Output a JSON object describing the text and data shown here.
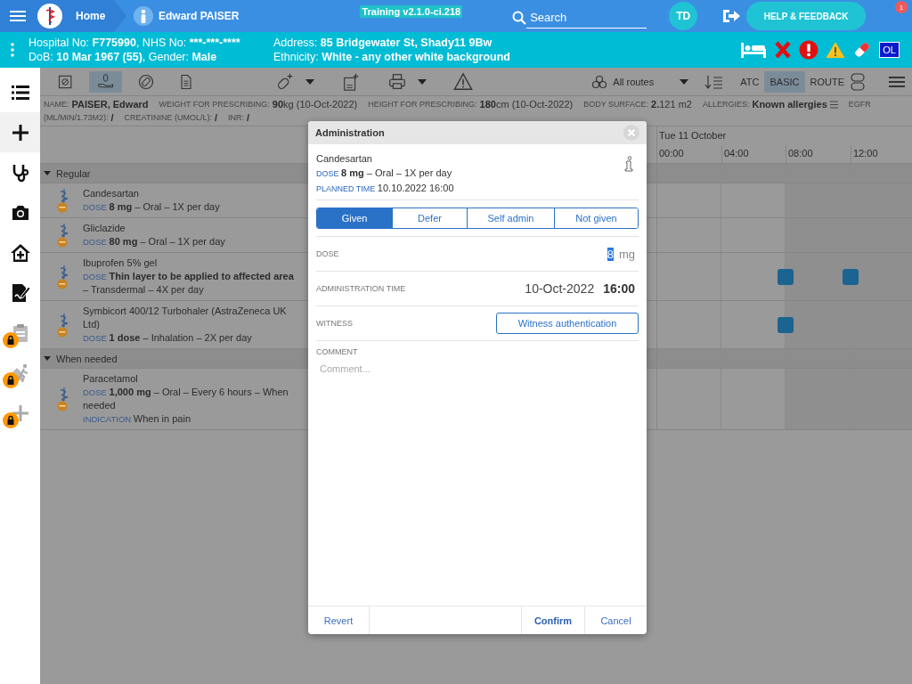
{
  "top_bar": {
    "home": "Home",
    "patient_name": "Edward PAISER",
    "version": "Training v2.1.0-ci.218",
    "search": {
      "placeholder": "Search"
    },
    "user_initials": "TD",
    "help_button": "HELP & FEEDBACK",
    "notification_count": "1"
  },
  "patient_banner": {
    "columns": [
      [
        [
          {
            "label": "Hospital No:",
            "value": "F775990"
          },
          {
            "label": ", NHS No:",
            "value": "***-***-****"
          }
        ],
        [
          {
            "label": "DoB:",
            "value": "10 Mar 1967 (55)"
          },
          {
            "label": ", Gender:",
            "value": "Male"
          }
        ]
      ],
      [
        [
          {
            "label": "Address:",
            "value": "85 Bridgewater St, Shady11 9Bw"
          }
        ],
        [
          {
            "label": "Ethnicity:",
            "value": "White - any other white background"
          }
        ]
      ]
    ],
    "alerts": [
      {
        "kind": "bed"
      },
      {
        "kind": "cross"
      },
      {
        "kind": "critical"
      },
      {
        "kind": "warning"
      },
      {
        "kind": "pill"
      },
      {
        "kind": "badge",
        "text": "OL"
      }
    ]
  },
  "sidebar": {
    "items": [
      {
        "kind": "list",
        "selected": false,
        "locked": false
      },
      {
        "kind": "add",
        "selected": true,
        "locked": false
      },
      {
        "kind": "stethoscope",
        "selected": false,
        "locked": false
      },
      {
        "kind": "camera",
        "selected": false,
        "locked": false
      },
      {
        "kind": "home",
        "selected": false,
        "locked": false
      },
      {
        "kind": "sign",
        "selected": false,
        "locked": false
      },
      {
        "kind": "clipboard",
        "selected": false,
        "locked": true
      },
      {
        "kind": "runner",
        "selected": false,
        "locked": true
      },
      {
        "kind": "add",
        "selected": false,
        "locked": true
      }
    ]
  },
  "toolbar": {
    "tools": [
      {
        "kind": "calendar",
        "selected": false
      },
      {
        "kind": "hand",
        "selected": true
      },
      {
        "kind": "pill-off",
        "selected": false
      },
      {
        "kind": "document",
        "selected": false
      }
    ],
    "actions": [
      {
        "kind": "add-pill",
        "dropdown": true
      },
      {
        "kind": "ref",
        "dropdown": false
      },
      {
        "kind": "print",
        "dropdown": true
      },
      {
        "kind": "warning",
        "dropdown": false
      }
    ],
    "route_filter": "All routes",
    "views": [
      {
        "label": "ATC",
        "selected": false
      },
      {
        "label": "BASIC",
        "selected": true
      },
      {
        "label": "ROUTE",
        "selected": false
      }
    ]
  },
  "patient_info": {
    "lines": [
      [
        {
          "label": "NAME:",
          "value": "PAISER, Edward"
        },
        {
          "label": "WEIGHT FOR PRESCRIBING:",
          "value": "90",
          "note": "kg (10-Oct-2022)"
        },
        {
          "label": "HEIGHT FOR PRESCRIBING:",
          "value": "180",
          "note": "cm (10-Oct-2022)"
        },
        {
          "label": "BODY SURFACE:",
          "value": "2.",
          "note": "121 m2"
        },
        {
          "label": "ALLERGIES:",
          "value": "Known allergies",
          "menu": true
        },
        {
          "label": "EGFR"
        }
      ],
      [
        {
          "label": "(ML/MIN/1.73M2):",
          "value": "/"
        },
        {
          "label": "CREATININE (UMOL/L):",
          "value": "/"
        },
        {
          "label": "INR:",
          "value": "/"
        }
      ]
    ]
  },
  "chart": {
    "date": "Tue 11 October",
    "times": [
      "00:00",
      "04:00",
      "08:00",
      "12:00"
    ]
  },
  "groups": [
    {
      "name": "Regular",
      "expanded": true,
      "medications": [
        {
          "name": "Candesartan",
          "dose_label": "DOSE",
          "dose": "**8 mg** – Oral – 1X per day",
          "scheduled": [
            false,
            false,
            false,
            false
          ]
        },
        {
          "name": "Gliclazide",
          "dose_label": "DOSE",
          "dose": "**80 mg** – Oral – 1X per day",
          "scheduled": [
            false,
            false,
            false,
            false
          ]
        },
        {
          "name": "Ibuprofen 5% gel",
          "dose_label": "DOSE",
          "dose": "**Thin layer to be applied to affected area** – Transdermal – 4X per day",
          "scheduled": [
            false,
            false,
            true,
            true
          ]
        },
        {
          "name": "Symbicort 400/12 Turbohaler (AstraZeneca UK Ltd)",
          "dose_label": "DOSE",
          "dose": "**1 dose** – Inhalation – 2X per day",
          "scheduled": [
            false,
            false,
            true,
            false
          ]
        }
      ]
    },
    {
      "name": "When needed",
      "expanded": true,
      "medications": [
        {
          "name": "Paracetamol",
          "dose_label": "DOSE",
          "dose": "**1,000 mg** – Oral – Every 6 hours – When needed",
          "indication_label": "INDICATION",
          "indication": "When in pain",
          "scheduled": [
            false,
            false,
            false,
            false
          ]
        }
      ]
    }
  ],
  "modal": {
    "title": "Administration",
    "drug": "Candesartan",
    "dose_label": "DOSE",
    "dose": "**8 mg** – Oral – 1X per day",
    "planned_label": "PLANNED TIME",
    "planned": "10.10.2022 16:00",
    "outcomes": [
      {
        "label": "Given",
        "selected": true
      },
      {
        "label": "Defer",
        "selected": false
      },
      {
        "label": "Self admin",
        "selected": false
      },
      {
        "label": "Not given",
        "selected": false
      }
    ],
    "dose_field": {
      "label": "DOSE",
      "value": "8",
      "unit": "mg"
    },
    "time_field": {
      "label": "ADMINISTRATION TIME",
      "date": "10-Oct-2022",
      "time": "16:00"
    },
    "witness_field": {
      "label": "WITNESS",
      "button": "Witness authentication"
    },
    "comment_field": {
      "label": "COMMENT",
      "placeholder": "Comment..."
    },
    "buttons": [
      {
        "label": "Revert",
        "kind": "secondary"
      },
      {
        "label": "Confirm",
        "kind": "primary"
      },
      {
        "label": "Cancel",
        "kind": "secondary"
      }
    ]
  }
}
